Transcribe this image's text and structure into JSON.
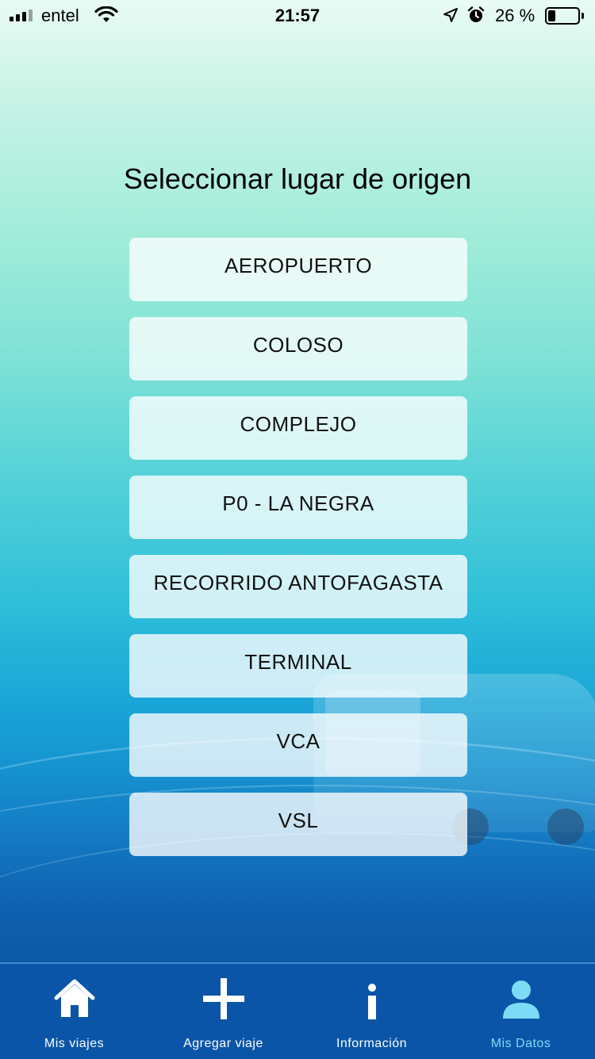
{
  "status_bar": {
    "carrier": "entel",
    "time": "21:57",
    "battery_percent": "26 %",
    "battery_level": 0.26
  },
  "screen": {
    "title": "Seleccionar lugar de origen"
  },
  "options": [
    {
      "label": "AEROPUERTO"
    },
    {
      "label": "COLOSO"
    },
    {
      "label": "COMPLEJO"
    },
    {
      "label": "P0 - LA NEGRA"
    },
    {
      "label": "RECORRIDO ANTOFAGASTA"
    },
    {
      "label": "TERMINAL"
    },
    {
      "label": "VCA"
    },
    {
      "label": "VSL"
    }
  ],
  "tab_bar": {
    "tabs": [
      {
        "label": "Mis viajes",
        "icon": "home-icon",
        "active": false
      },
      {
        "label": "Agregar viaje",
        "icon": "plus-icon",
        "active": false
      },
      {
        "label": "Información",
        "icon": "info-icon",
        "active": false
      },
      {
        "label": "Mis Datos",
        "icon": "user-icon",
        "active": true
      }
    ]
  },
  "colors": {
    "tab_bar_background": "#0b55a8",
    "active_tab_color": "#7ddcf5",
    "inactive_tab_color": "#ffffff"
  }
}
